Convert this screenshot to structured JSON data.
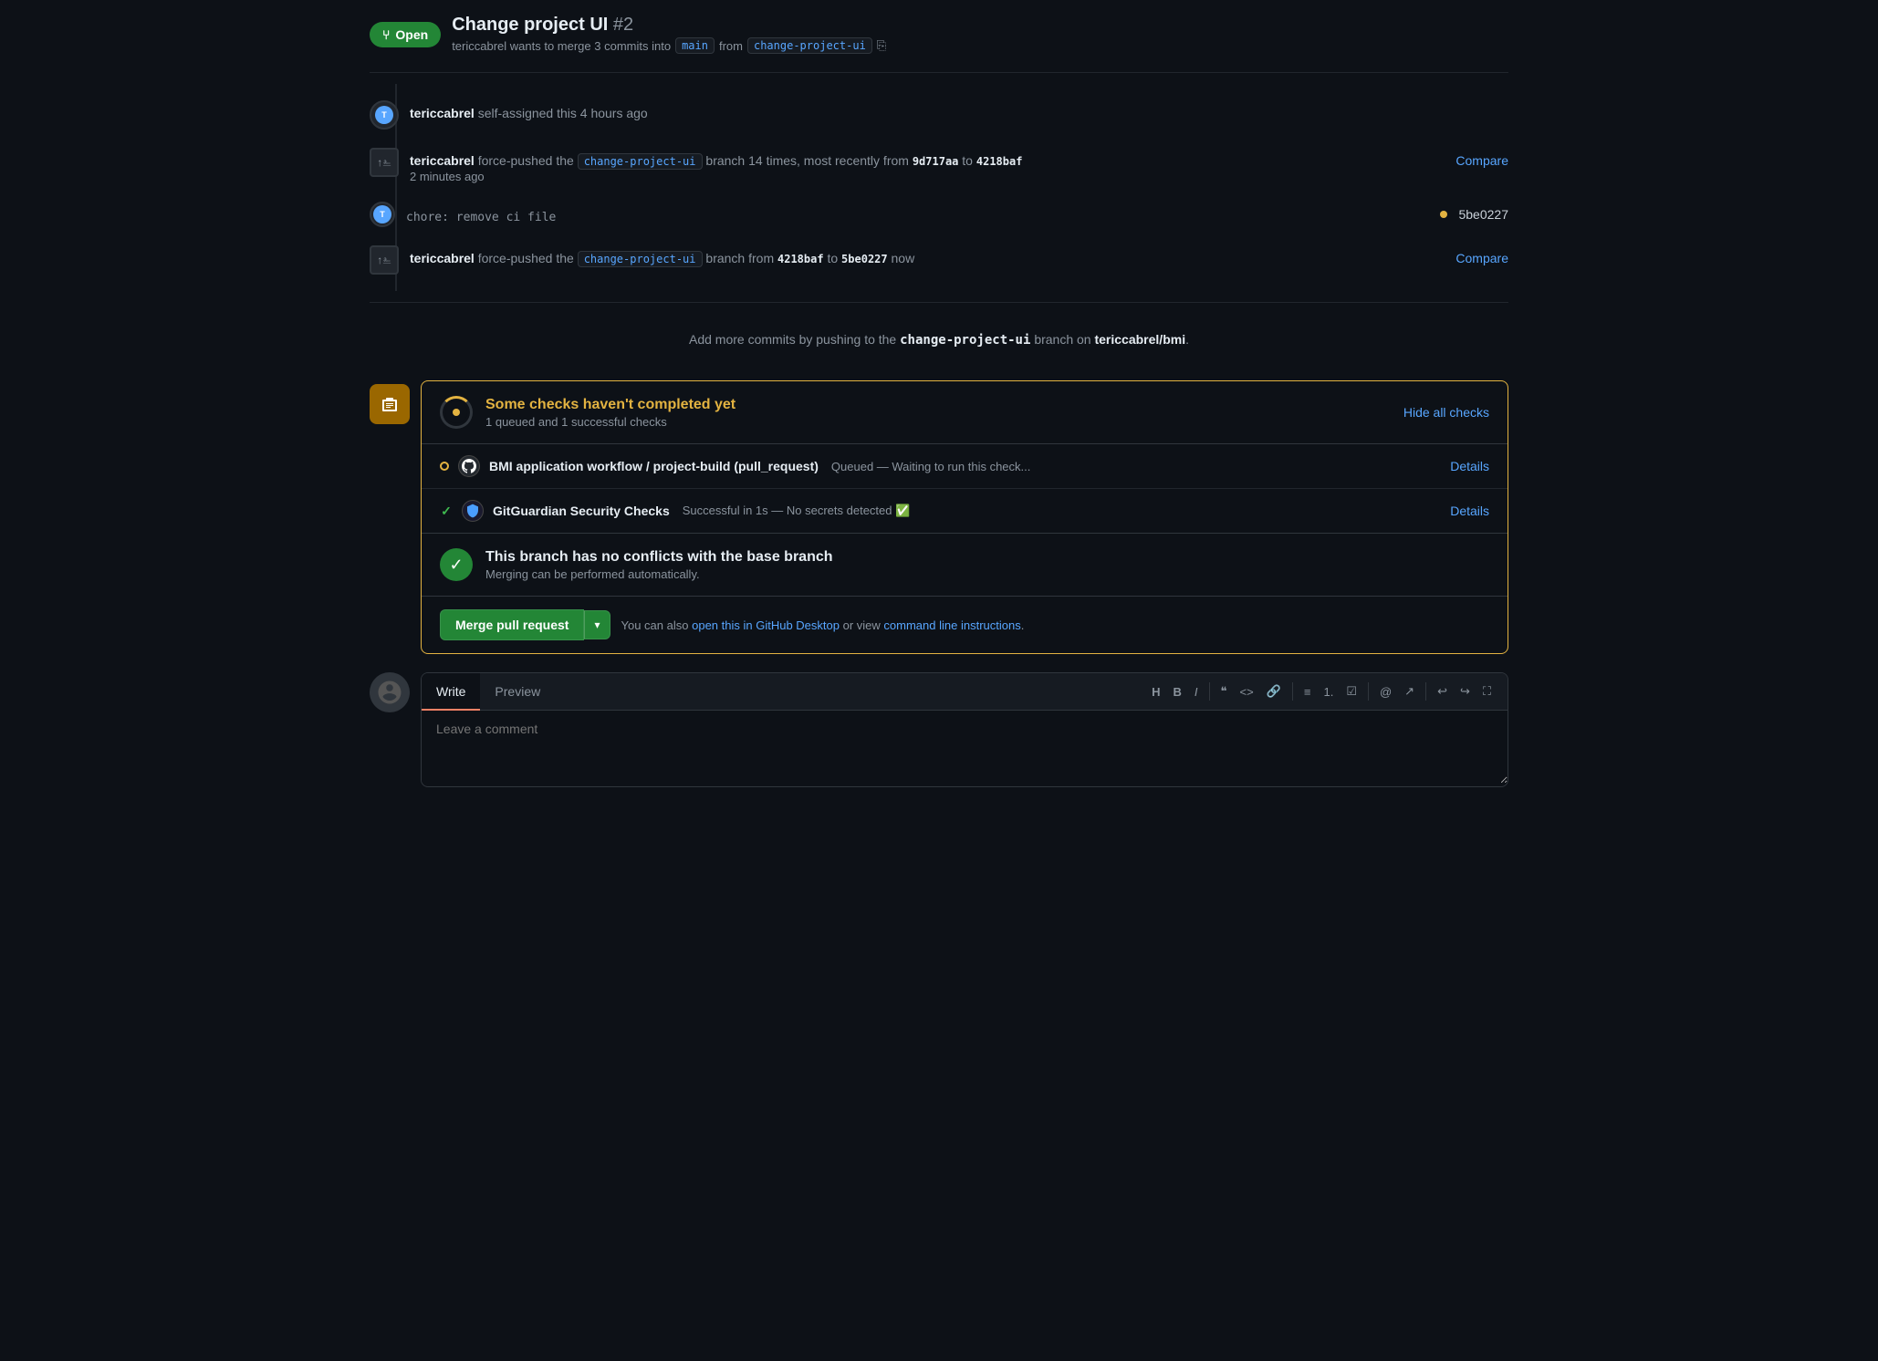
{
  "pr": {
    "title": "Change project UI",
    "number": "#2",
    "status": "Open",
    "subtitle": "tericcabrel wants to merge 3 commits into",
    "base_branch": "main",
    "compare_branch": "change-project-ui"
  },
  "timeline": {
    "event1": {
      "actor": "tericcabrel",
      "action": "self-assigned this 4 hours ago"
    },
    "event2": {
      "actor": "tericcabrel",
      "action_pre": "force-pushed the",
      "branch": "change-project-ui",
      "action_mid": "branch 14 times, most recently from",
      "from_hash": "9d717aa",
      "action_to": "to",
      "to_hash": "4218baf",
      "time": "2 minutes ago",
      "compare_label": "Compare"
    },
    "event3": {
      "message": "chore: remove ci file",
      "hash": "5be0227"
    },
    "event4": {
      "actor": "tericcabrel",
      "action_pre": "force-pushed the",
      "branch": "change-project-ui",
      "action_mid": "branch from",
      "from_hash": "4218baf",
      "action_to": "to",
      "to_hash": "5be0227",
      "time": "now",
      "compare_label": "Compare"
    }
  },
  "add_commits": {
    "text_pre": "Add more commits by pushing to the",
    "branch": "change-project-ui",
    "text_mid": "branch on",
    "repo": "tericcabrel/bmi",
    "text_end": "."
  },
  "checks": {
    "panel_title": "Some checks haven't completed yet",
    "panel_subtitle": "1 queued and 1 successful checks",
    "hide_label": "Hide all checks",
    "items": [
      {
        "id": "bmi-workflow",
        "status": "queued",
        "name": "BMI application workflow / project-build (pull_request)",
        "description": "Queued — Waiting to run this check...",
        "details_label": "Details"
      },
      {
        "id": "gitguardian",
        "status": "success",
        "name": "GitGuardian Security Checks",
        "description": "Successful in 1s — No secrets detected ✅",
        "details_label": "Details"
      }
    ],
    "merge": {
      "title": "This branch has no conflicts with the base branch",
      "subtitle": "Merging can be performed automatically."
    },
    "merge_button": {
      "label": "Merge pull request",
      "dropdown_icon": "▾",
      "also_text": "You can also",
      "github_desktop_link": "open this in GitHub Desktop",
      "or_text": "or view",
      "cli_link": "command line instructions",
      "end_text": "."
    }
  },
  "comment_box": {
    "write_tab": "Write",
    "preview_tab": "Preview",
    "placeholder": "Leave a comment",
    "toolbar": {
      "heading": "H",
      "bold": "B",
      "italic": "I",
      "quote": "❝",
      "code_inline": "<>",
      "link": "🔗",
      "unordered_list": "≡",
      "ordered_list": "1.",
      "task_list": "☑",
      "mention": "@",
      "reference": "↗",
      "undo": "↩",
      "redo": "↪"
    }
  },
  "icons": {
    "open_icon": "⑂",
    "git_icon": "⑂",
    "push_icon": "↑",
    "commit_icon": "●",
    "check_mark": "✓"
  },
  "colors": {
    "success_green": "#238636",
    "warning_yellow": "#e3b341",
    "blue_link": "#58a6ff",
    "text_muted": "#8b949e",
    "border": "#30363d",
    "bg_dark": "#0d1117",
    "bg_secondary": "#161b22"
  }
}
